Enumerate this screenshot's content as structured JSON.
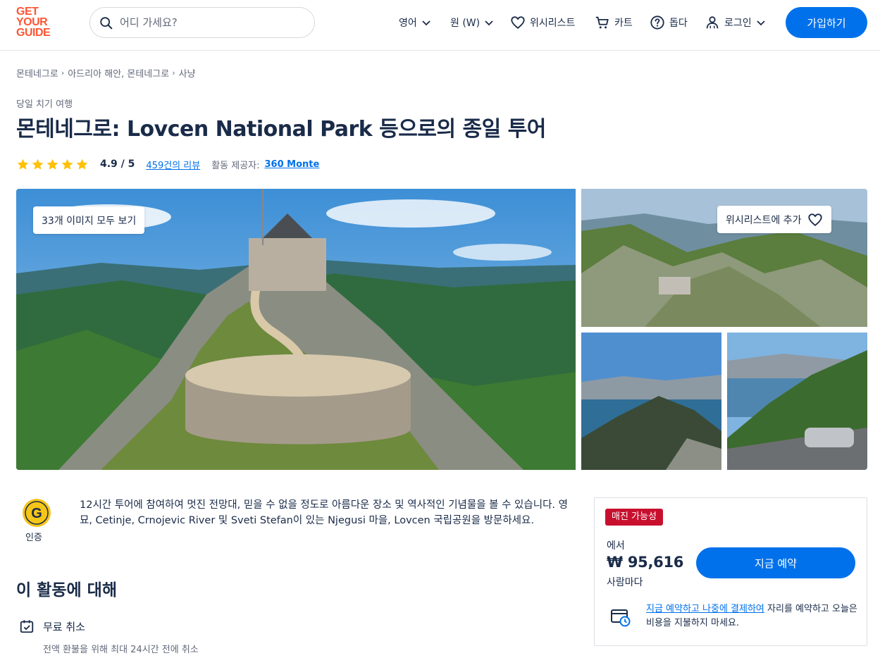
{
  "header": {
    "logo_lines": [
      "GET",
      "YOUR",
      "GUIDE"
    ],
    "search_placeholder": "어디 가세요?",
    "language_label": "영어",
    "currency_label": "원 (W)",
    "wishlist_label": "위시리스트",
    "cart_label": "카트",
    "help_label": "돕다",
    "login_label": "로그인",
    "signup_label": "가입하기",
    "icons": [
      "search-icon",
      "chevron-down-icon",
      "heart-icon",
      "cart-icon",
      "help-icon",
      "user-icon"
    ]
  },
  "breadcrumb": [
    "몬테네그로",
    "아드리아 해안, 몬테네그로",
    "사냥"
  ],
  "activity": {
    "category": "당일 치기 여행",
    "title": "몬테네그로: Lovcen National Park 등으로의 종일 투어",
    "rating_score": "4.9 / 5",
    "stars": 5,
    "reviews_link": "459건의 리뷰",
    "provider_label": "활동 제공자:",
    "provider_name": "360 Monte"
  },
  "gallery": {
    "view_all_label": "33개 이미지 모두 보기",
    "wishlist_add_label": "위시리스트에 추가"
  },
  "certified": {
    "badge_letter": "G",
    "label": "인증"
  },
  "description": "12시간 투어에 참여하여 멋진 전망대, 믿을 수 없을 정도로 아름다운 장소 및 역사적인 기념물을 볼 수 있습니다. 영묘, Cetinje, Crnojevic River 및 Sveti Stefan이 있는 Njegusi 마을, Lovcen 국립공원을 방문하세요.",
  "about": {
    "section_title": "이 활동에 대해",
    "free_cancel_title": "무료 취소",
    "free_cancel_desc": "전액 환불을 위해 최대 24시간 전에 취소"
  },
  "booking": {
    "sellout_badge": "매진 가능성",
    "from_label": "에서",
    "price": "₩ 95,616",
    "per_person": "사람마다",
    "book_now_label": "지금 예약",
    "rnpl_link": "지금 예약하고 나중에 결제하여",
    "rnpl_text": " 자리를 예약하고 오늘은 비용을 지불하지 마세요."
  },
  "colors": {
    "brand_orange": "#ff5533",
    "primary_blue": "#0071eb",
    "text_dark": "#1a2b49",
    "text_muted": "#63687a",
    "star_yellow": "#ffc107",
    "sellout_red": "#c8102e"
  }
}
